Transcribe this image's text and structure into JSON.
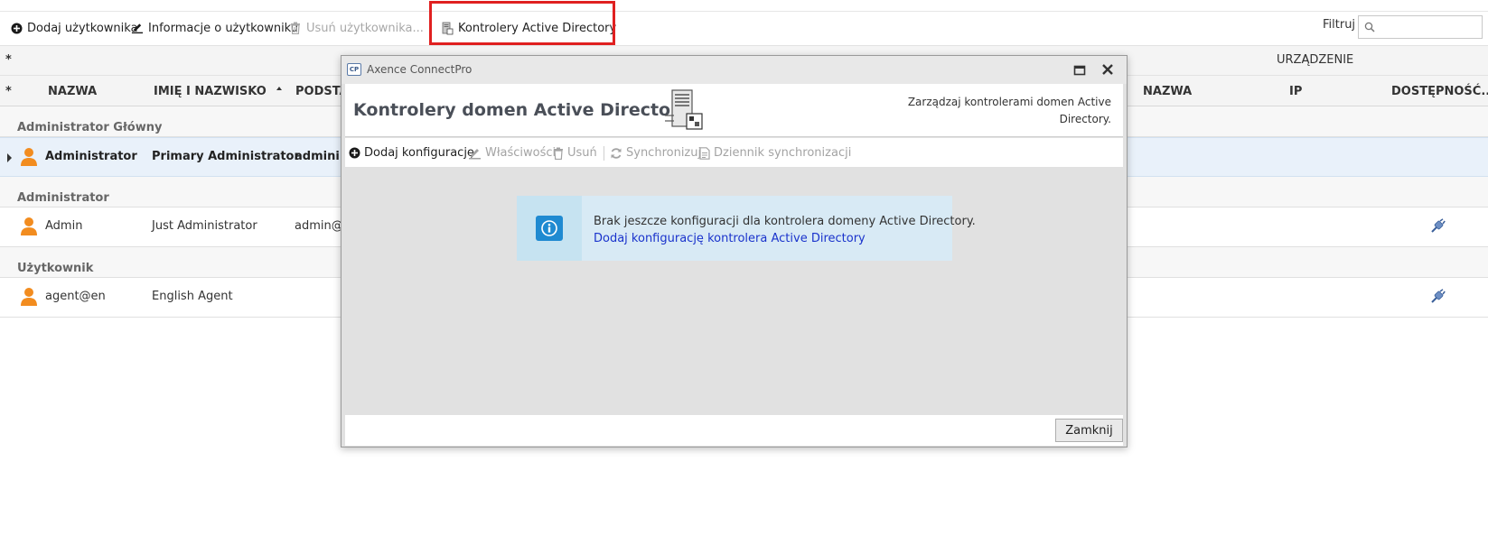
{
  "toolbar": {
    "add_user": "Dodaj użytkownika",
    "user_info": "Informacje o użytkowniku",
    "delete_user": "Usuń użytkownika...",
    "ad_controllers": "Kontrolery Active Directory"
  },
  "filter": {
    "label": "Filtruj",
    "value": ""
  },
  "grid": {
    "group_header_device": "URZĄDZENIE",
    "star": "*",
    "columns": {
      "name": "NAZWA",
      "full_name": "IMIĘ I NAZWISKO",
      "podsta": "PODSTA",
      "device_name": "NAZWA",
      "ip": "IP",
      "availability": "DOSTĘPNOŚĆ..."
    },
    "groups": [
      {
        "label": "Administrator Główny",
        "rows": [
          {
            "name": "Administrator",
            "full_name": "Primary Administrator",
            "login": "admini:"
          }
        ]
      },
      {
        "label": "Administrator",
        "rows": [
          {
            "name": "Admin",
            "full_name": "Just Administrator",
            "login": "admin@"
          }
        ]
      },
      {
        "label": "Użytkownik",
        "rows": [
          {
            "name": "agent@en",
            "full_name": "English Agent",
            "login": ""
          }
        ]
      }
    ]
  },
  "dialog": {
    "app_title": "Axence ConnectPro",
    "app_icon": "CP",
    "heading": "Kontrolery domen Active Directory",
    "description": "Zarządzaj kontrolerami domen Active Directory.",
    "toolbar": {
      "add_config": "Dodaj konfigurację",
      "properties": "Właściwości",
      "delete": "Usuń",
      "synchronize": "Synchronizuj",
      "sync_log": "Dziennik synchronizacji"
    },
    "info": {
      "message": "Brak jeszcze konfiguracji dla kontrolera domeny Active Directory.",
      "link": "Dodaj konfigurację kontrolera Active Directory"
    },
    "close_button": "Zamknij"
  }
}
